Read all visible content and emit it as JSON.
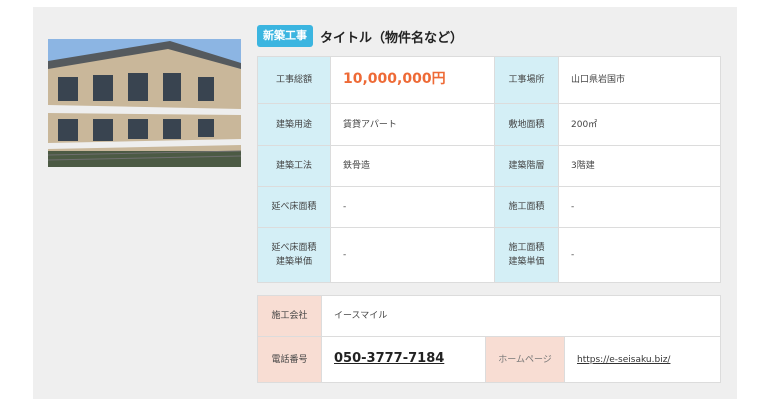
{
  "header": {
    "badge": "新築工事",
    "title": "タイトル（物件名など）"
  },
  "photo": {
    "icon": "apartment-building-photo"
  },
  "details": {
    "rows": [
      {
        "l1": "工事総額",
        "v1": "10,000,000円",
        "l2": "工事場所",
        "v2": "山口県岩国市"
      },
      {
        "l1": "建築用途",
        "v1": "賃貸アパート",
        "l2": "敷地面積",
        "v2": "200㎡"
      },
      {
        "l1": "建築工法",
        "v1": "鉄骨造",
        "l2": "建築階層",
        "v2": "3階建"
      },
      {
        "l1": "延べ床面積",
        "v1": "-",
        "l2": "施工面積",
        "v2": "-"
      },
      {
        "l1a": "延べ床面積",
        "l1b": "建築単価",
        "v1": "-",
        "l2a": "施工面積",
        "l2b": "建築単価",
        "v2": "-"
      }
    ]
  },
  "contractor": {
    "company_label": "施工会社",
    "company": "イースマイル",
    "phone_label": "電話番号",
    "phone": "050-3777-7184",
    "homepage_label": "ホームページ",
    "homepage": "https://e-seisaku.biz/"
  },
  "colors": {
    "badge": "#3bb5e0",
    "price": "#ee6a36",
    "label_blue": "#d4eff6",
    "label_pink": "#f8ddd3"
  }
}
